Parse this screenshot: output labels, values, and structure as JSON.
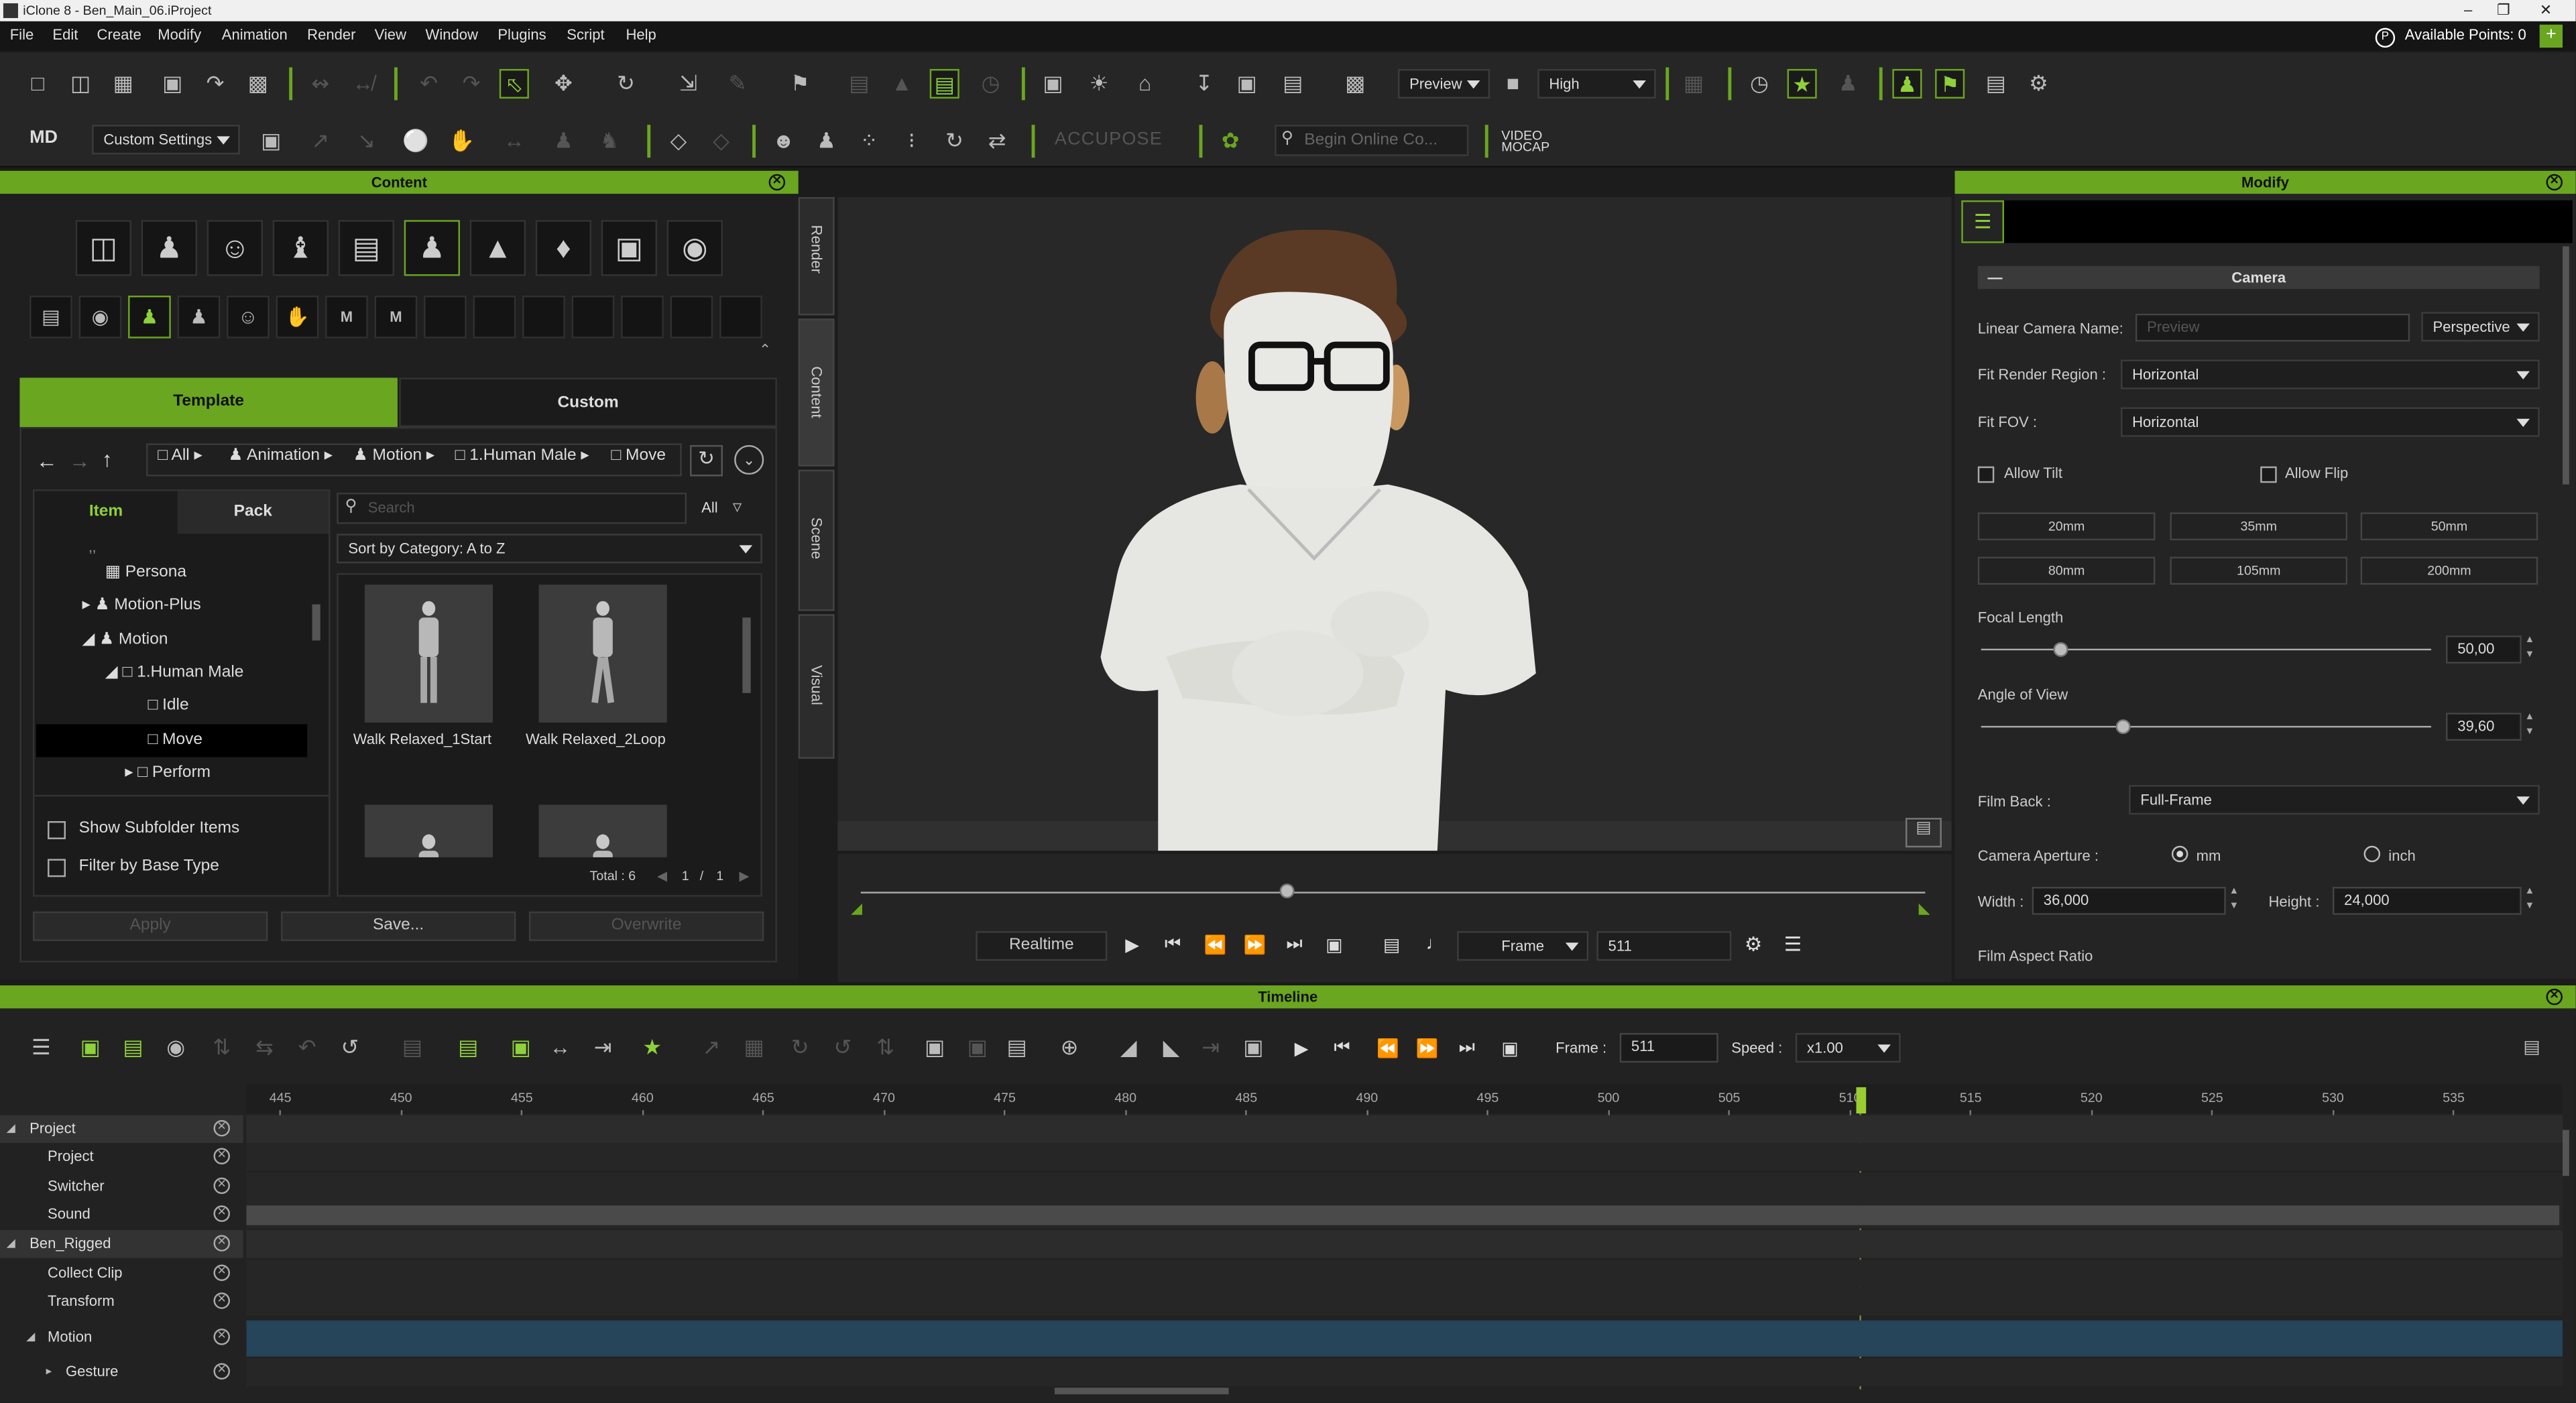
{
  "window": {
    "title": "iClone 8 - Ben_Main_06.iProject"
  },
  "menu": [
    "File",
    "Edit",
    "Create",
    "Modify",
    "Animation",
    "Render",
    "View",
    "Window",
    "Plugins",
    "Script",
    "Help"
  ],
  "account": {
    "points_label": "Available Points: 0",
    "points_icon": "P",
    "add": "+"
  },
  "toolbar": {
    "preview_mode": "Preview",
    "quality": "High",
    "custom_settings": "Custom Settings",
    "accupose": "ACCUPOSE",
    "online_search_placeholder": "Begin Online Co...",
    "video_mocap": "VIDEO MOCAP",
    "md_logo": "MD"
  },
  "content": {
    "header": "Content",
    "tabs": {
      "template": "Template",
      "custom": "Custom"
    },
    "breadcrumb": [
      "All",
      "Animation",
      "Motion",
      "1.Human Male",
      "Move"
    ],
    "subtabs": {
      "item": "Item",
      "pack": "Pack"
    },
    "search_placeholder": "Search",
    "filter_all": "All",
    "sort": "Sort by Category: A to Z",
    "tree": [
      {
        "label": "Persona",
        "level": 2
      },
      {
        "label": "Motion-Plus",
        "level": 1
      },
      {
        "label": "Motion",
        "level": 1
      },
      {
        "label": "1.Human Male",
        "level": 2
      },
      {
        "label": "Idle",
        "level": 3
      },
      {
        "label": "Move",
        "level": 3,
        "selected": true
      },
      {
        "label": "Perform",
        "level": 3
      }
    ],
    "items": [
      {
        "label": "Walk Relaxed_1Start"
      },
      {
        "label": "Walk Relaxed_2Loop"
      }
    ],
    "total": "Total : 6",
    "page": "1",
    "page_total": "1",
    "page_sep": "/",
    "show_subfolder": "Show Subfolder Items",
    "filter_base": "Filter by Base Type",
    "buttons": {
      "apply": "Apply",
      "save": "Save...",
      "overwrite": "Overwrite"
    },
    "side_tabs": [
      "Render",
      "Content",
      "Scene",
      "Visual"
    ]
  },
  "viewport": {
    "playback_mode": "Realtime",
    "frame_label": "Frame",
    "frame_value": "511"
  },
  "modify": {
    "header": "Modify",
    "section": "Camera",
    "section_toggle": "—",
    "camera_name_label": "Linear Camera Name:",
    "camera_name_placeholder": "Preview",
    "projection": "Perspective",
    "fit_render_label": "Fit Render Region :",
    "fit_render_value": "Horizontal",
    "fit_fov_label": "Fit FOV :",
    "fit_fov_value": "Horizontal",
    "allow_tilt": "Allow Tilt",
    "allow_flip": "Allow Flip",
    "lens_presets": [
      "20mm",
      "35mm",
      "50mm",
      "80mm",
      "105mm",
      "200mm"
    ],
    "focal_length_label": "Focal Length",
    "focal_length_value": "50,00",
    "angle_of_view_label": "Angle of View",
    "angle_of_view_value": "39,60",
    "film_back_label": "Film Back :",
    "film_back_value": "Full-Frame",
    "aperture_label": "Camera Aperture :",
    "aperture_mm": "mm",
    "aperture_inch": "inch",
    "width_label": "Width :",
    "width_value": "36,000",
    "height_label": "Height :",
    "height_value": "24,000",
    "film_aspect_label": "Film Aspect Ratio"
  },
  "timeline": {
    "header": "Timeline",
    "frame_label": "Frame :",
    "frame_value": "511",
    "speed_label": "Speed :",
    "speed_value": "x1.00",
    "ruler": [
      "445",
      "450",
      "455",
      "460",
      "465",
      "470",
      "475",
      "480",
      "485",
      "490",
      "495",
      "500",
      "505",
      "510",
      "515",
      "520",
      "525",
      "530",
      "535"
    ],
    "tracks": [
      {
        "label": "Project",
        "level": 0,
        "group": true
      },
      {
        "label": "Project",
        "level": 1
      },
      {
        "label": "Switcher",
        "level": 1
      },
      {
        "label": "Sound",
        "level": 1
      },
      {
        "label": "Ben_Rigged",
        "level": 0,
        "group": true
      },
      {
        "label": "Collect Clip",
        "level": 1
      },
      {
        "label": "Transform",
        "level": 1
      },
      {
        "label": "Motion",
        "level": 1
      },
      {
        "label": "Gesture",
        "level": 2
      }
    ]
  },
  "colors": {
    "accent": "#6aa620",
    "bg": "#1c1c1c",
    "panel": "#242424"
  }
}
